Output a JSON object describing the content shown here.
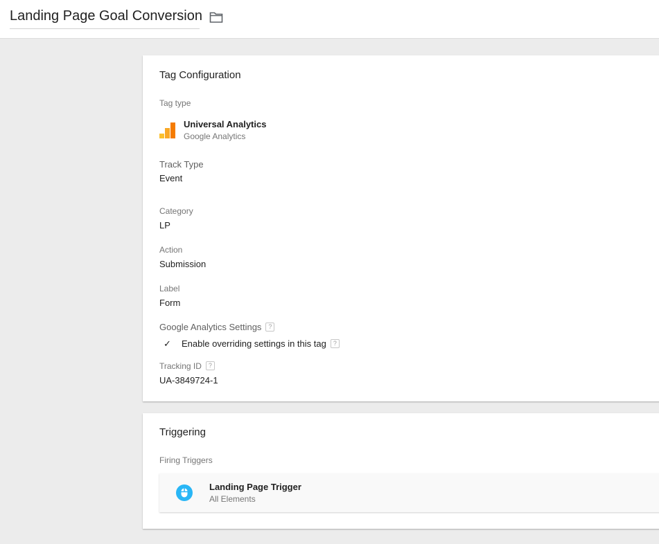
{
  "header": {
    "title": "Landing Page Goal Conversion",
    "folder_icon": "folder-icon"
  },
  "tag_configuration": {
    "title": "Tag Configuration",
    "tag_type_label": "Tag type",
    "tag_type_name": "Universal Analytics",
    "tag_type_vendor": "Google Analytics",
    "tag_type_icon": "google-analytics-icon",
    "track_type_label": "Track Type",
    "track_type_value": "Event",
    "category_label": "Category",
    "category_value": "LP",
    "action_label": "Action",
    "action_value": "Submission",
    "label_label": "Label",
    "label_value": "Form",
    "ga_settings_label": "Google Analytics Settings",
    "override_label": "Enable overriding settings in this tag",
    "override_checked": true,
    "tracking_id_label": "Tracking ID",
    "tracking_id_value": "UA-3849724-1",
    "help_glyph": "?"
  },
  "triggering": {
    "title": "Triggering",
    "firing_label": "Firing Triggers",
    "trigger_name": "Landing Page Trigger",
    "trigger_type": "All Elements",
    "trigger_icon": "click-icon"
  },
  "colors": {
    "ga_orange": "#f57c00",
    "ga_yellow": "#fbc02d",
    "trigger_blue": "#29b6f6"
  }
}
